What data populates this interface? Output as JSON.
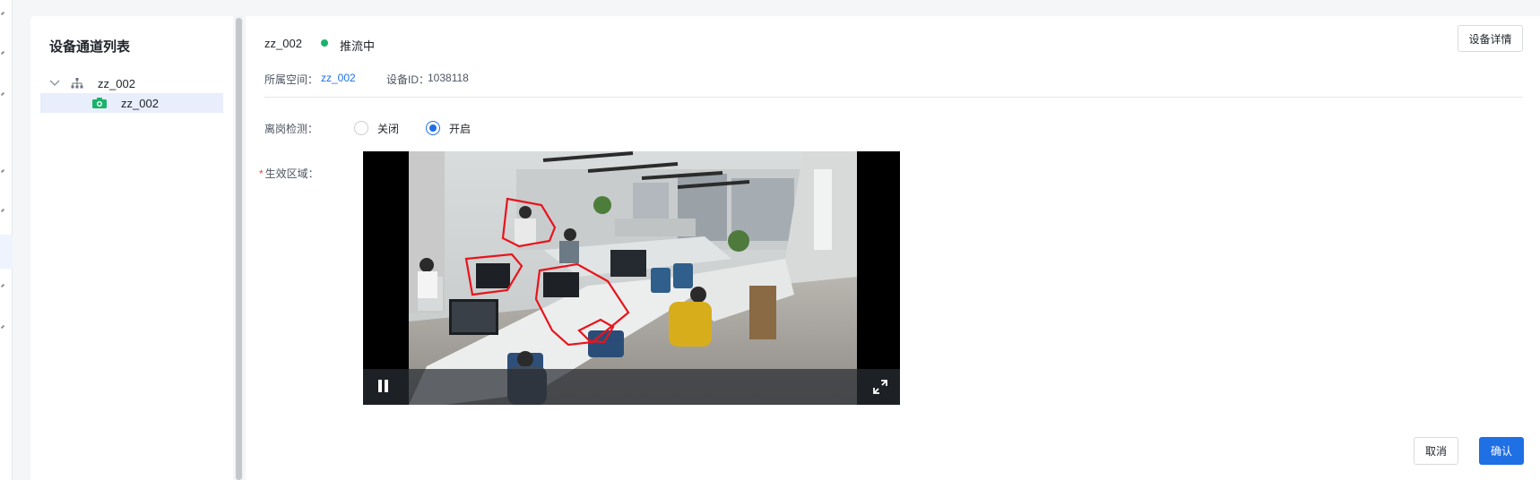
{
  "sidebar": {
    "title": "设备通道列表",
    "tree": [
      {
        "label": "zz_002",
        "icon": "org-tree-icon",
        "expanded": true
      },
      {
        "label": "zz_002",
        "icon": "camera-icon",
        "selected": true
      }
    ]
  },
  "device": {
    "name": "zz_002",
    "status": "推流中",
    "status_color": "#19b36b",
    "detail_button": "设备详情",
    "space_label": "所属空间：",
    "space_value": "zz_002",
    "id_label": "设备ID：",
    "id_value": "1038118"
  },
  "form": {
    "leave_detect_label": "离岗检测：",
    "options": [
      "关闭",
      "开启"
    ],
    "selected_option": "开启",
    "region_required_mark": "*",
    "region_label": "生效区域："
  },
  "video": {
    "state": "playing",
    "controls": [
      "pause-icon",
      "fullscreen-icon"
    ]
  },
  "footer": {
    "cancel": "取消",
    "confirm": "确认"
  },
  "colors": {
    "accent": "#1f6fe5",
    "region_outline": "#e8141c"
  }
}
